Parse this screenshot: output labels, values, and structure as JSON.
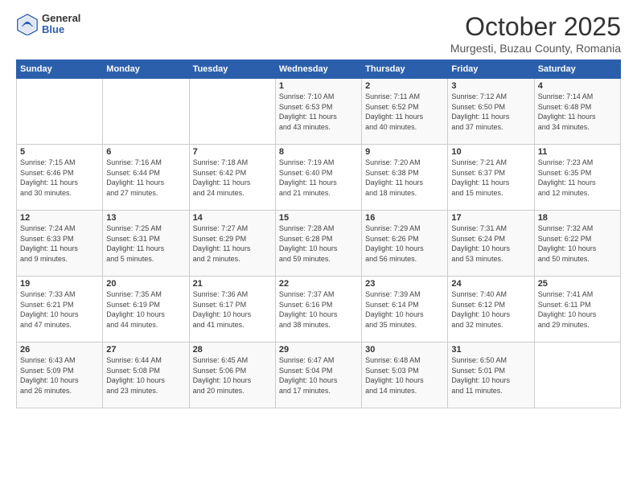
{
  "logo": {
    "general": "General",
    "blue": "Blue"
  },
  "header": {
    "title": "October 2025",
    "subtitle": "Murgesti, Buzau County, Romania"
  },
  "weekdays": [
    "Sunday",
    "Monday",
    "Tuesday",
    "Wednesday",
    "Thursday",
    "Friday",
    "Saturday"
  ],
  "weeks": [
    [
      {
        "day": "",
        "info": ""
      },
      {
        "day": "",
        "info": ""
      },
      {
        "day": "",
        "info": ""
      },
      {
        "day": "1",
        "info": "Sunrise: 7:10 AM\nSunset: 6:53 PM\nDaylight: 11 hours\nand 43 minutes."
      },
      {
        "day": "2",
        "info": "Sunrise: 7:11 AM\nSunset: 6:52 PM\nDaylight: 11 hours\nand 40 minutes."
      },
      {
        "day": "3",
        "info": "Sunrise: 7:12 AM\nSunset: 6:50 PM\nDaylight: 11 hours\nand 37 minutes."
      },
      {
        "day": "4",
        "info": "Sunrise: 7:14 AM\nSunset: 6:48 PM\nDaylight: 11 hours\nand 34 minutes."
      }
    ],
    [
      {
        "day": "5",
        "info": "Sunrise: 7:15 AM\nSunset: 6:46 PM\nDaylight: 11 hours\nand 30 minutes."
      },
      {
        "day": "6",
        "info": "Sunrise: 7:16 AM\nSunset: 6:44 PM\nDaylight: 11 hours\nand 27 minutes."
      },
      {
        "day": "7",
        "info": "Sunrise: 7:18 AM\nSunset: 6:42 PM\nDaylight: 11 hours\nand 24 minutes."
      },
      {
        "day": "8",
        "info": "Sunrise: 7:19 AM\nSunset: 6:40 PM\nDaylight: 11 hours\nand 21 minutes."
      },
      {
        "day": "9",
        "info": "Sunrise: 7:20 AM\nSunset: 6:38 PM\nDaylight: 11 hours\nand 18 minutes."
      },
      {
        "day": "10",
        "info": "Sunrise: 7:21 AM\nSunset: 6:37 PM\nDaylight: 11 hours\nand 15 minutes."
      },
      {
        "day": "11",
        "info": "Sunrise: 7:23 AM\nSunset: 6:35 PM\nDaylight: 11 hours\nand 12 minutes."
      }
    ],
    [
      {
        "day": "12",
        "info": "Sunrise: 7:24 AM\nSunset: 6:33 PM\nDaylight: 11 hours\nand 9 minutes."
      },
      {
        "day": "13",
        "info": "Sunrise: 7:25 AM\nSunset: 6:31 PM\nDaylight: 11 hours\nand 5 minutes."
      },
      {
        "day": "14",
        "info": "Sunrise: 7:27 AM\nSunset: 6:29 PM\nDaylight: 11 hours\nand 2 minutes."
      },
      {
        "day": "15",
        "info": "Sunrise: 7:28 AM\nSunset: 6:28 PM\nDaylight: 10 hours\nand 59 minutes."
      },
      {
        "day": "16",
        "info": "Sunrise: 7:29 AM\nSunset: 6:26 PM\nDaylight: 10 hours\nand 56 minutes."
      },
      {
        "day": "17",
        "info": "Sunrise: 7:31 AM\nSunset: 6:24 PM\nDaylight: 10 hours\nand 53 minutes."
      },
      {
        "day": "18",
        "info": "Sunrise: 7:32 AM\nSunset: 6:22 PM\nDaylight: 10 hours\nand 50 minutes."
      }
    ],
    [
      {
        "day": "19",
        "info": "Sunrise: 7:33 AM\nSunset: 6:21 PM\nDaylight: 10 hours\nand 47 minutes."
      },
      {
        "day": "20",
        "info": "Sunrise: 7:35 AM\nSunset: 6:19 PM\nDaylight: 10 hours\nand 44 minutes."
      },
      {
        "day": "21",
        "info": "Sunrise: 7:36 AM\nSunset: 6:17 PM\nDaylight: 10 hours\nand 41 minutes."
      },
      {
        "day": "22",
        "info": "Sunrise: 7:37 AM\nSunset: 6:16 PM\nDaylight: 10 hours\nand 38 minutes."
      },
      {
        "day": "23",
        "info": "Sunrise: 7:39 AM\nSunset: 6:14 PM\nDaylight: 10 hours\nand 35 minutes."
      },
      {
        "day": "24",
        "info": "Sunrise: 7:40 AM\nSunset: 6:12 PM\nDaylight: 10 hours\nand 32 minutes."
      },
      {
        "day": "25",
        "info": "Sunrise: 7:41 AM\nSunset: 6:11 PM\nDaylight: 10 hours\nand 29 minutes."
      }
    ],
    [
      {
        "day": "26",
        "info": "Sunrise: 6:43 AM\nSunset: 5:09 PM\nDaylight: 10 hours\nand 26 minutes."
      },
      {
        "day": "27",
        "info": "Sunrise: 6:44 AM\nSunset: 5:08 PM\nDaylight: 10 hours\nand 23 minutes."
      },
      {
        "day": "28",
        "info": "Sunrise: 6:45 AM\nSunset: 5:06 PM\nDaylight: 10 hours\nand 20 minutes."
      },
      {
        "day": "29",
        "info": "Sunrise: 6:47 AM\nSunset: 5:04 PM\nDaylight: 10 hours\nand 17 minutes."
      },
      {
        "day": "30",
        "info": "Sunrise: 6:48 AM\nSunset: 5:03 PM\nDaylight: 10 hours\nand 14 minutes."
      },
      {
        "day": "31",
        "info": "Sunrise: 6:50 AM\nSunset: 5:01 PM\nDaylight: 10 hours\nand 11 minutes."
      },
      {
        "day": "",
        "info": ""
      }
    ]
  ]
}
